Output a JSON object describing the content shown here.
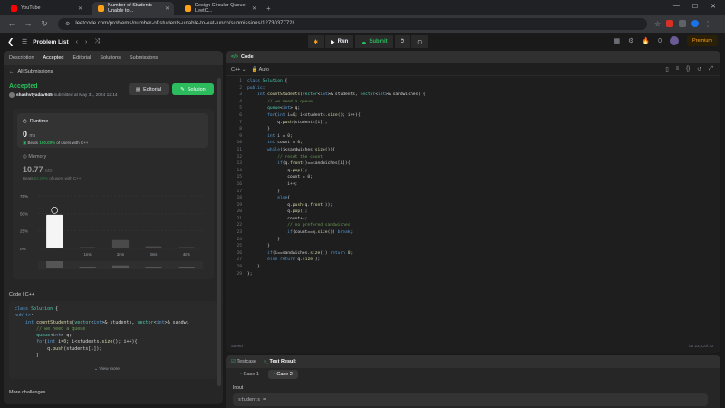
{
  "browser": {
    "tabs": [
      {
        "title": "YouTube",
        "active": false
      },
      {
        "title": "Number of Students Unable to...",
        "active": true
      },
      {
        "title": "Design Circular Queue - LeetC...",
        "active": false
      }
    ],
    "url": "leetcode.com/problems/number-of-students-unable-to-eat-lunch/submissions/1273037772/"
  },
  "header": {
    "problem_list": "Problem List",
    "run": "Run",
    "submit": "Submit",
    "streak": "0",
    "premium": "Premium"
  },
  "left": {
    "tabs": [
      "Description",
      "Accepted",
      "Editorial",
      "Solutions",
      "Submissions"
    ],
    "all_submissions": "All Submissions",
    "status": "Accepted",
    "user": "shashvtyadav945",
    "submitted": "submitted at May 31, 2024 12:14",
    "editorial_btn": "Editorial",
    "solution_btn": "Solution",
    "runtime": {
      "title": "Runtime",
      "value": "0",
      "unit": "ms",
      "beats_label": "Beats",
      "beats": "100.00%",
      "suffix": "of users with C++"
    },
    "memory": {
      "title": "Memory",
      "value": "10.77",
      "unit": "MB",
      "beats_label": "Beats",
      "beats": "52.09%",
      "suffix": "of users with C++"
    },
    "code_header": "Code  |  C++",
    "view_more": "View more",
    "more_challenges": "More challenges"
  },
  "chart_data": {
    "type": "bar",
    "yticks": [
      "75%",
      "50%",
      "25%",
      "0%"
    ],
    "ylim": [
      0,
      75
    ],
    "categories": [
      "",
      "1ms",
      "2ms",
      "3ms",
      "4ms"
    ],
    "values": [
      48,
      2,
      12,
      3,
      2
    ],
    "highlight_index": 0,
    "xlabel": "",
    "ylabel": ""
  },
  "preview_code": [
    "class Solution {",
    "public:",
    "    int countStudents(vector<int>& students, vector<int>& sandwi",
    "        // we need a queue",
    "        queue<int> q;",
    "        for(int i=0; i<students.size(); i++){",
    "            q.push(students[i]);",
    "        }"
  ],
  "editor": {
    "title": "Code",
    "lang": "C++",
    "mode": "Auto",
    "saved": "Saved",
    "cursor": "Ln 23, Col 10",
    "lines": [
      "class Solution {",
      "public:",
      "    int countStudents(vector<int>& students, vector<int>& sandwiches) {",
      "        // we need a queue",
      "        queue<int> q;",
      "        for(int i=0; i<students.size(); i++){",
      "            q.push(students[i]);",
      "        }",
      "        int i = 0;",
      "        int count = 0;",
      "        while(i<sandwiches.size()){",
      "            // reset the count",
      "            if(q.front()==sandwiches[i]){",
      "                q.pop();",
      "                count = 0;",
      "                i++;",
      "            }",
      "            else{",
      "                q.push(q.front());",
      "                q.pop();",
      "                count++;",
      "                // no prefered sandwiches",
      "                if(count==q.size()) break;",
      "            }",
      "        }",
      "        if(i==sandwiches.size()) return 0;",
      "        else return q.size();",
      "    }",
      "};"
    ]
  },
  "testpane": {
    "tabs": [
      "Testcase",
      "Test Result"
    ],
    "cases": [
      "Case 1",
      "Case 2"
    ],
    "input_label": "Input",
    "input_value": "students ="
  }
}
